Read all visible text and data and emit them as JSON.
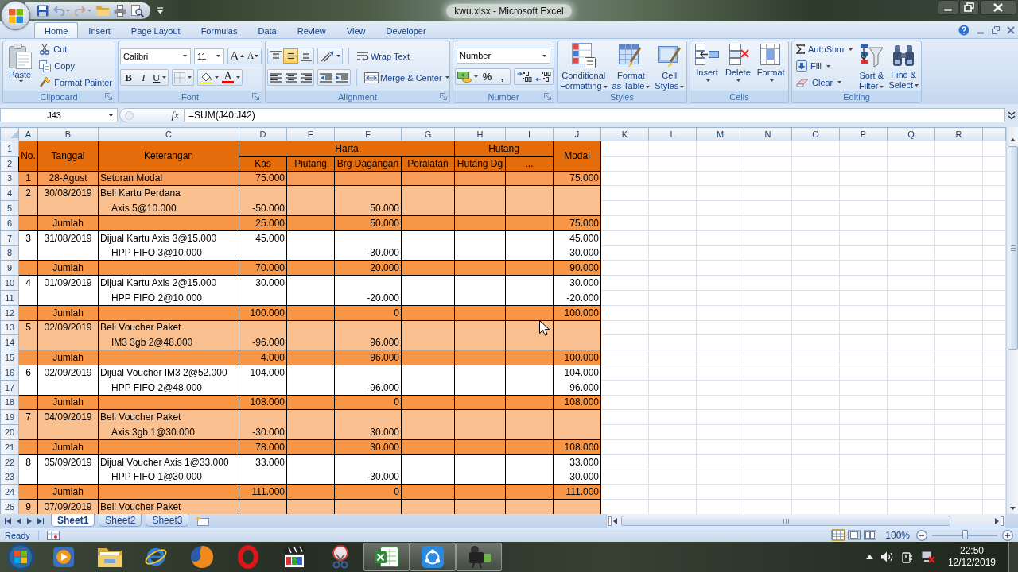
{
  "window": {
    "title": "kwu.xlsx - Microsoft Excel"
  },
  "ribbon_tabs": [
    {
      "label": "Home",
      "selected": true
    },
    {
      "label": "Insert",
      "selected": false
    },
    {
      "label": "Page Layout",
      "selected": false
    },
    {
      "label": "Formulas",
      "selected": false
    },
    {
      "label": "Data",
      "selected": false
    },
    {
      "label": "Review",
      "selected": false
    },
    {
      "label": "View",
      "selected": false
    },
    {
      "label": "Developer",
      "selected": false
    }
  ],
  "clipboard": {
    "label": "Clipboard",
    "paste": "Paste",
    "commands": [
      {
        "kind": "cut",
        "label": "Cut"
      },
      {
        "kind": "copy",
        "label": "Copy"
      },
      {
        "kind": "format_painter",
        "label": "Format Painter"
      }
    ]
  },
  "font": {
    "label": "Font",
    "name": "Calibri",
    "size": "11",
    "grow": "A",
    "shrink": "A",
    "emphasis": [
      {
        "kind": "bold",
        "label": "B"
      },
      {
        "kind": "italic",
        "label": "I"
      },
      {
        "kind": "underline",
        "label": "U"
      }
    ],
    "color_letter": "A"
  },
  "alignment": {
    "label": "Alignment",
    "vertical": [
      {
        "kind": "top",
        "selected": false
      },
      {
        "kind": "middle",
        "selected": true
      },
      {
        "kind": "bottom",
        "selected": false
      }
    ],
    "wrap_text": "Wrap Text",
    "merge_center": "Merge & Center"
  },
  "number": {
    "label": "Number",
    "format": "Number",
    "percent": "%",
    "comma": ","
  },
  "styles": {
    "label": "Styles",
    "buttons": [
      {
        "kind": "conditional",
        "label": "Conditional\nFormatting"
      },
      {
        "kind": "table",
        "label": "Format\nas Table"
      },
      {
        "kind": "cell_styles",
        "label": "Cell\nStyles"
      }
    ]
  },
  "cells": {
    "label": "Cells",
    "buttons": [
      {
        "kind": "insert",
        "label": "Insert"
      },
      {
        "kind": "delete",
        "label": "Delete"
      },
      {
        "kind": "format",
        "label": "Format"
      }
    ]
  },
  "editing": {
    "label": "Editing",
    "commands": [
      {
        "kind": "autosum",
        "label": "AutoSum"
      },
      {
        "kind": "fill",
        "label": "Fill"
      },
      {
        "kind": "clear",
        "label": "Clear"
      }
    ],
    "buttons": [
      {
        "kind": "sort",
        "label": "Sort &\nFilter"
      },
      {
        "kind": "find",
        "label": "Find &\nSelect"
      }
    ]
  },
  "formula_bar": {
    "name_box": "J43",
    "function_label": "fx",
    "formula": "=SUM(J40:J42)"
  },
  "sheet": {
    "columns": [
      "A",
      "B",
      "C",
      "D",
      "E",
      "F",
      "G",
      "H",
      "I",
      "J",
      "K",
      "L",
      "M",
      "N",
      "O",
      "P",
      "Q",
      "R"
    ],
    "row_numbers": [
      "1",
      "2",
      "3",
      "4",
      "5",
      "6",
      "7",
      "8",
      "9",
      "10",
      "11",
      "12",
      "13",
      "14",
      "15",
      "16",
      "17",
      "18",
      "19",
      "20",
      "21",
      "22",
      "23",
      "24",
      "25"
    ],
    "header": {
      "no": "No.",
      "tanggal": "Tanggal",
      "keterangan": "Keterangan",
      "harta": "Harta",
      "hutang": "Hutang",
      "modal": "Modal",
      "subcolumns": [
        "Kas",
        "Piutang",
        "Brg Dagangan",
        "Peralatan",
        "Hutang Dg",
        "..."
      ]
    },
    "rows": [
      {
        "kind": "opening",
        "no": "1",
        "tanggal": "28-Agust",
        "keterangan": "Setoran Modal",
        "kas": "75.000",
        "modal": "75.000"
      },
      {
        "kind": "purchase",
        "no": "2",
        "tanggal": "30/08/2019",
        "keterangan": "Beli Kartu Perdana"
      },
      {
        "kind": "purchase",
        "keterangan": "Axis 5@10.000",
        "detail": true,
        "kas": "-50.000",
        "brg_dagangan": "50.000"
      },
      {
        "kind": "total",
        "tanggal": "Jumlah",
        "kas": "25.000",
        "brg_dagangan": "50.000",
        "modal": "75.000"
      },
      {
        "kind": "sale",
        "no": "3",
        "tanggal": "31/08/2019",
        "keterangan": "Dijual Kartu Axis 3@15.000",
        "kas": "45.000",
        "modal": "45.000"
      },
      {
        "kind": "sale",
        "keterangan": "HPP FIFO 3@10.000",
        "detail": true,
        "brg_dagangan": "-30.000",
        "modal": "-30.000"
      },
      {
        "kind": "total",
        "tanggal": "Jumlah",
        "kas": "70.000",
        "brg_dagangan": "20.000",
        "modal": "90.000"
      },
      {
        "kind": "sale",
        "no": "4",
        "tanggal": "01/09/2019",
        "keterangan": "Dijual Kartu Axis 2@15.000",
        "kas": "30.000",
        "modal": "30.000"
      },
      {
        "kind": "sale",
        "keterangan": "HPP FIFO 2@10.000",
        "detail": true,
        "brg_dagangan": "-20.000",
        "modal": "-20.000"
      },
      {
        "kind": "total",
        "tanggal": "Jumlah",
        "kas": "100.000",
        "brg_dagangan": "0",
        "modal": "100.000"
      },
      {
        "kind": "purchase",
        "no": "5",
        "tanggal": "02/09/2019",
        "keterangan": "Beli Voucher Paket"
      },
      {
        "kind": "purchase",
        "keterangan": "IM3 3gb 2@48.000",
        "detail": true,
        "kas": "-96.000",
        "brg_dagangan": "96.000"
      },
      {
        "kind": "total",
        "tanggal": "Jumlah",
        "kas": "4.000",
        "brg_dagangan": "96.000",
        "modal": "100.000"
      },
      {
        "kind": "sale",
        "no": "6",
        "tanggal": "02/09/2019",
        "keterangan": "Dijual Voucher IM3 2@52.000",
        "kas": "104.000",
        "modal": "104.000"
      },
      {
        "kind": "sale",
        "keterangan": "HPP FIFO 2@48.000",
        "detail": true,
        "brg_dagangan": "-96.000",
        "modal": "-96.000"
      },
      {
        "kind": "total",
        "tanggal": "Jumlah",
        "kas": "108.000",
        "brg_dagangan": "0",
        "modal": "108.000"
      },
      {
        "kind": "purchase",
        "no": "7",
        "tanggal": "04/09/2019",
        "keterangan": "Beli Voucher Paket"
      },
      {
        "kind": "purchase",
        "keterangan": "Axis 3gb 1@30.000",
        "detail": true,
        "kas": "-30.000",
        "brg_dagangan": "30.000"
      },
      {
        "kind": "total",
        "tanggal": "Jumlah",
        "kas": "78.000",
        "brg_dagangan": "30.000",
        "modal": "108.000"
      },
      {
        "kind": "sale",
        "no": "8",
        "tanggal": "05/09/2019",
        "keterangan": "Dijual Voucher Axis 1@33.000",
        "kas": "33.000",
        "modal": "33.000"
      },
      {
        "kind": "sale",
        "keterangan": "HPP FIFO 1@30.000",
        "detail": true,
        "brg_dagangan": "-30.000",
        "modal": "-30.000"
      },
      {
        "kind": "total",
        "tanggal": "Jumlah",
        "kas": "111.000",
        "brg_dagangan": "0",
        "modal": "111.000"
      },
      {
        "kind": "purchase",
        "no": "9",
        "tanggal": "07/09/2019",
        "keterangan": "Beli Voucher Paket"
      }
    ]
  },
  "sheet_tabs": [
    {
      "label": "Sheet1",
      "selected": true
    },
    {
      "label": "Sheet2",
      "selected": false
    },
    {
      "label": "Sheet3",
      "selected": false
    }
  ],
  "status_bar": {
    "status": "Ready",
    "views": [
      {
        "kind": "normal",
        "selected": true
      },
      {
        "kind": "page_layout",
        "selected": false
      },
      {
        "kind": "page_break",
        "selected": false
      }
    ],
    "zoom": "100%",
    "zoom_slider": {
      "level": 0.5
    }
  },
  "taskbar": {
    "apps": [
      {
        "kind": "play",
        "running": false
      },
      {
        "kind": "folders",
        "running": false
      },
      {
        "kind": "orbit_globe",
        "running": false
      },
      {
        "kind": "globe",
        "running": false
      },
      {
        "kind": "ring",
        "running": false
      },
      {
        "kind": "clapperboard",
        "running": false
      },
      {
        "kind": "scissors",
        "running": false
      },
      {
        "kind": "spreadsheet",
        "running": true
      },
      {
        "kind": "share",
        "running": true
      },
      {
        "kind": "camcorder",
        "running": true
      }
    ],
    "time": "22:50",
    "date": "12/12/2019"
  }
}
